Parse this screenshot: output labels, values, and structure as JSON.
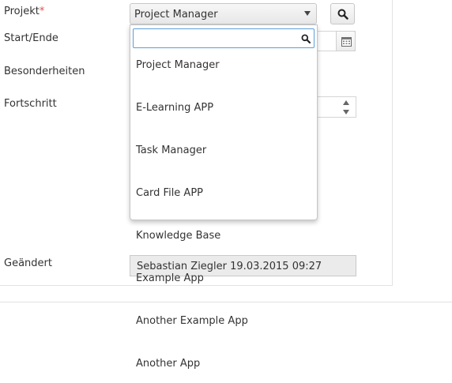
{
  "form": {
    "project_label": "Projekt",
    "required_mark": "*",
    "start_end_label": "Start/Ende",
    "special_label": "Besonderheiten",
    "progress_label": "Fortschritt",
    "changed_label": "Geändert",
    "project_value": "Project Manager",
    "changed_value": "Sebastian Ziegler 19.03.2015 09:27"
  },
  "dropdown": {
    "search_value": "",
    "options": [
      "Project Manager",
      "E-Learning APP",
      "Task Manager",
      "Card File APP",
      "Knowledge Base",
      "Example App",
      "Another Example App",
      "Another App"
    ]
  },
  "icons": {
    "search": "search-icon",
    "calendar": "calendar-icon",
    "select_arrow": "chevron-down-icon",
    "spin_up": "spinner-up-icon",
    "spin_down": "spinner-down-icon"
  }
}
